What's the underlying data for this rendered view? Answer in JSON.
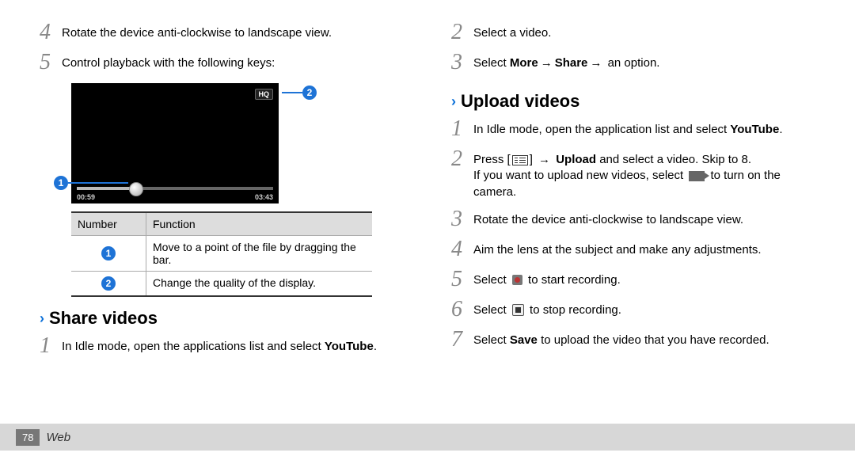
{
  "left": {
    "step4": "Rotate the device anti-clockwise to landscape view.",
    "step5": "Control playback with the following keys:",
    "player": {
      "hq": "HQ",
      "current": "00:59",
      "total": "03:43"
    },
    "callouts": {
      "c1": "1",
      "c2": "2"
    },
    "table": {
      "h1": "Number",
      "h2": "Function",
      "r1": "Move to a point of the file by dragging the bar.",
      "r2": "Change the quality of the display."
    },
    "share_title": "Share videos",
    "share_step1a": "In Idle mode, open the applications list and select ",
    "share_step1b": "YouTube",
    "share_step1c": "."
  },
  "right": {
    "step2": "Select a video.",
    "step3a": "Select ",
    "step3b": "More",
    "step3c": "Share",
    "step3d": " an option.",
    "upload_title": "Upload videos",
    "u1a": "In Idle mode, open the application list and select ",
    "u1b": "YouTube",
    "u1c": ".",
    "u2a": "Press [",
    "u2b": "] ",
    "u2c": "Upload",
    "u2d": " and select a video. Skip to 8.",
    "u2e": "If you want to upload new videos, select ",
    "u2f": " to turn on the camera.",
    "u3": "Rotate the device anti-clockwise to landscape view.",
    "u4": "Aim the lens at the subject and make any adjustments.",
    "u5a": "Select ",
    "u5b": " to start recording.",
    "u6a": "Select ",
    "u6b": " to stop recording.",
    "u7a": "Select ",
    "u7b": "Save",
    "u7c": " to upload the video that you have recorded."
  },
  "arrow": "→",
  "footer": {
    "page": "78",
    "section": "Web"
  },
  "nums": {
    "n1": "1",
    "n2": "2",
    "n3": "3",
    "n4": "4",
    "n5": "5",
    "n6": "6",
    "n7": "7"
  }
}
